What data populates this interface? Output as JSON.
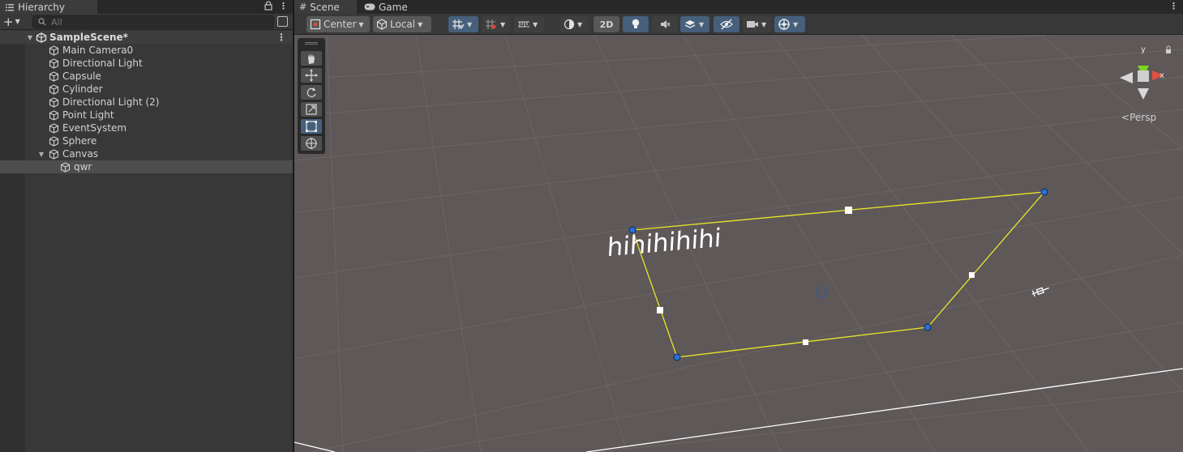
{
  "hierarchy": {
    "tab_label": "Hierarchy",
    "search_placeholder": "All",
    "scene_name": "SampleScene*",
    "items": [
      {
        "label": "Main Camera0"
      },
      {
        "label": "Directional Light"
      },
      {
        "label": "Capsule"
      },
      {
        "label": "Cylinder"
      },
      {
        "label": "Directional Light (2)"
      },
      {
        "label": "Point Light"
      },
      {
        "label": "EventSystem"
      },
      {
        "label": "Sphere"
      },
      {
        "label": "Canvas"
      },
      {
        "label": "qwr"
      }
    ]
  },
  "scene": {
    "tabs": [
      {
        "label": "Scene"
      },
      {
        "label": "Game"
      }
    ],
    "toolbar": {
      "pivot_label": "Center",
      "space_label": "Local",
      "mode_2d_label": "2D"
    },
    "canvas_text": "hihihihihi",
    "persp_label": "Persp",
    "gizmo_axes": {
      "y": "y",
      "x": "x"
    }
  },
  "colors": {
    "accent_blue": "#46607c",
    "rect_outline": "#e8e52a",
    "handle_blue": "#2a6fd6",
    "viewport_bg": "#5e5858"
  }
}
